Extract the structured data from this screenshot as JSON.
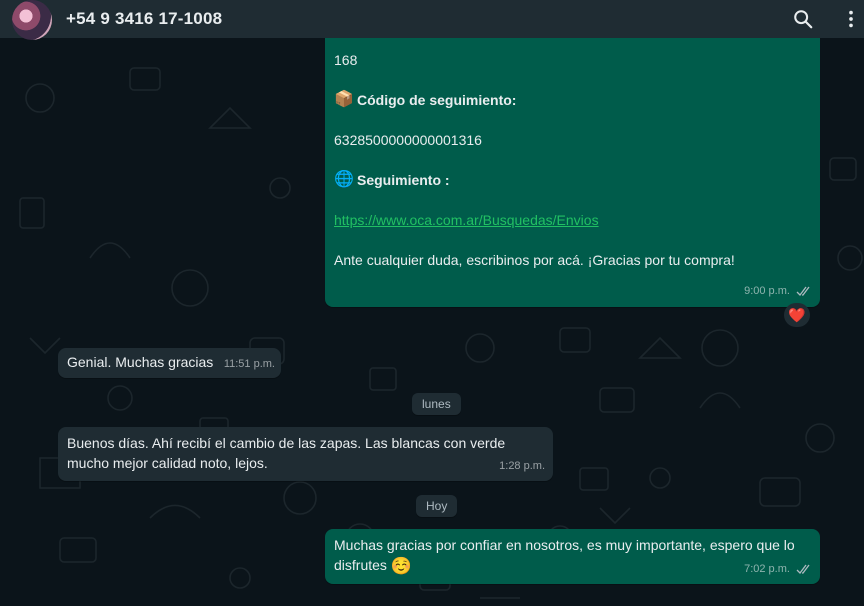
{
  "header": {
    "contact_name": "+54 9 3416 17-1008",
    "icons": [
      "search-icon",
      "menu-icon"
    ]
  },
  "messages": {
    "order": {
      "number": "168",
      "tracking_title": "Código de seguimiento:",
      "tracking_icon": "package-icon",
      "tracking_code": "6328500000000001316",
      "follow_title": "Seguimiento :",
      "follow_icon": "globe-icon",
      "link": "https://www.oca.com.ar/Busquedas/Envios",
      "closing": "Ante cualquier duda, escribinos por acá. ¡Gracias por tu compra!",
      "time": "9:00 p.m.",
      "reaction": "❤️"
    },
    "genial": {
      "text": "Genial. Muchas gracias",
      "time": "11:51 p.m."
    },
    "day_lunes": "lunes",
    "buenos": {
      "line1": "Buenos días. Ahí recibí el cambio de las zapas. Las blancas con verde",
      "line2": "mucho mejor calidad noto, lejos.",
      "time": "1:28 p.m."
    },
    "day_hoy": "Hoy",
    "gracias": {
      "line1": "Muchas gracias por confiar en nosotros, es muy importante, espero que lo",
      "line2": "disfrutes",
      "emoji": "☺️",
      "time": "7:02 p.m."
    }
  },
  "colors": {
    "outgoing_bubble": "#005c4b",
    "incoming_bubble": "#1f2c33",
    "background": "#0b141a",
    "link": "#21c063"
  }
}
